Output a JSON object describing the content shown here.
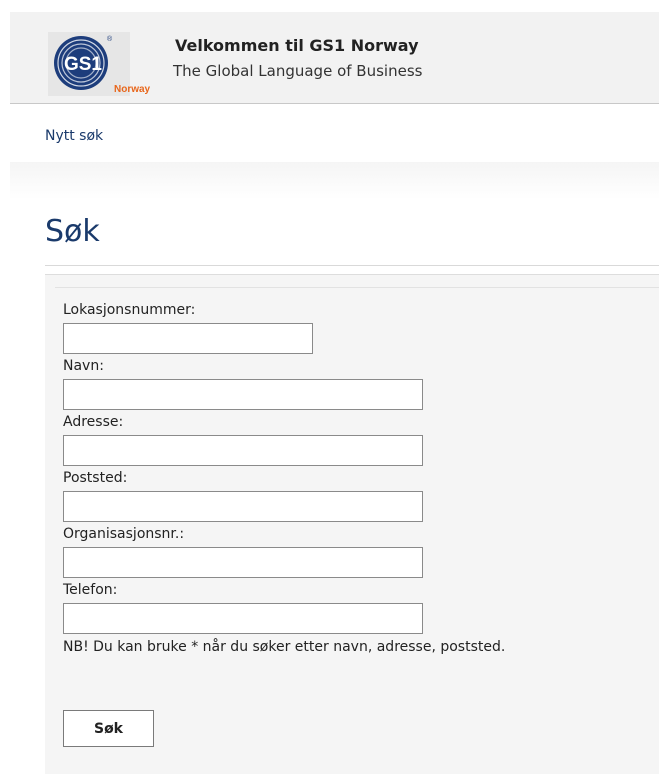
{
  "header": {
    "logo_text": "GS1",
    "logo_subtext": "Norway",
    "title": "Velkommen til GS1 Norway",
    "subtitle": "The Global Language of Business"
  },
  "nav": {
    "new_search": "Nytt søk"
  },
  "page": {
    "title": "Søk"
  },
  "form": {
    "fields": [
      {
        "label": "Lokasjonsnummer:",
        "value": ""
      },
      {
        "label": "Navn:",
        "value": ""
      },
      {
        "label": "Adresse:",
        "value": ""
      },
      {
        "label": "Poststed:",
        "value": ""
      },
      {
        "label": "Organisasjonsnr.:",
        "value": ""
      },
      {
        "label": "Telefon:",
        "value": ""
      }
    ],
    "note": "NB! Du kan bruke * når du søker etter navn, adresse, poststed.",
    "submit_label": "Søk"
  },
  "colors": {
    "brand_blue": "#1a3a6b",
    "logo_orange": "#e8661b",
    "panel_bg": "#f5f5f5"
  }
}
